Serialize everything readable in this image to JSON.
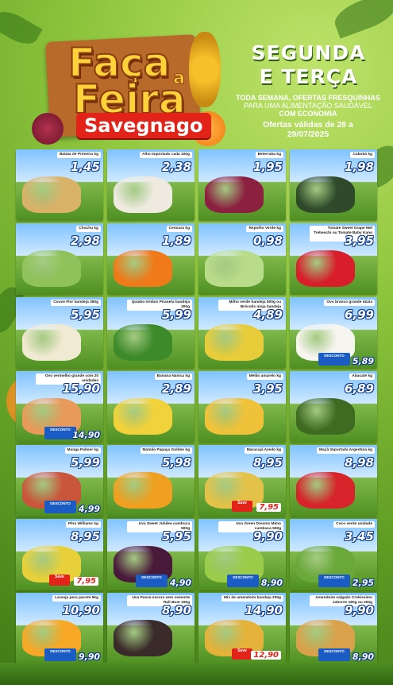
{
  "header": {
    "logo_line1": "Faça",
    "logo_connector": "a",
    "logo_line2": "Feira",
    "brand": "Savegnago",
    "days_line1": "SEGUNDA",
    "days_line2": "E TERÇA",
    "subtitle_line1": "TODA SEMANA, OFERTAS FRESQUINHAS",
    "subtitle_line2": "PARA UMA ALIMENTAÇÃO SAUDÁVEL",
    "subtitle_line3": "COM ECONOMIA",
    "validity_line1": "Ofertas válidas de 28 a",
    "validity_line2": "29/07/2025"
  },
  "currency": "R$",
  "products": [
    {
      "name": "Batata de Primeira kg",
      "price": "1,45",
      "color": "#d9b26a"
    },
    {
      "name": "Alho Importado cada 100g",
      "price": "2,38",
      "color": "#eeeae0"
    },
    {
      "name": "Beterraba kg",
      "price": "1,95",
      "color": "#8c2040"
    },
    {
      "name": "Cabotiá kg",
      "price": "1,98",
      "color": "#2f4a2a"
    },
    {
      "name": "Chuchu kg",
      "price": "2,98",
      "color": "#8fc25a"
    },
    {
      "name": "Cenoura kg",
      "price": "1,89",
      "color": "#f07a1a"
    },
    {
      "name": "Repolho Verde kg",
      "price": "0,98",
      "color": "#b9dc8a"
    },
    {
      "name": "Tomate Sweet Grape Mel Trebeschi ou Tomate Baby Kano 180g",
      "price": "3,95",
      "color": "#d81e2a"
    },
    {
      "name": "Couve Flor bandeja 350g",
      "price": "5,95",
      "color": "#f1ead2"
    },
    {
      "name": "Quiabo Irmãos Piraneta bandeja 300g",
      "price": "5,99",
      "color": "#3d8a2a"
    },
    {
      "name": "Milho verde bandeja 500g ou Brócolis ninja bandeja",
      "price": "4,89",
      "color": "#e8cc3a"
    },
    {
      "name": "Ovo branco grande dúzia",
      "price": "6,99",
      "color": "#f7f5ef",
      "discount_label": "DESCONTO",
      "discount_price": "5,89"
    },
    {
      "name": "Ovo vermelho grande com 20 unidades",
      "price": "15,90",
      "color": "#e89a5a",
      "discount_label": "DESCONTO",
      "discount_price": "14,90"
    },
    {
      "name": "Banana Nanica kg",
      "price": "2,89",
      "color": "#f2d23a"
    },
    {
      "name": "Melão amarelo kg",
      "price": "3,95",
      "color": "#f0c23a"
    },
    {
      "name": "Abacate kg",
      "price": "6,89",
      "color": "#3f6a22"
    },
    {
      "name": "Manga Palmer kg",
      "price": "5,99",
      "color": "#c9553a",
      "discount_label": "DESCONTO",
      "discount_price": "4,99"
    },
    {
      "name": "Mamão Papaya Golden kg",
      "price": "5,98",
      "color": "#f0a020"
    },
    {
      "name": "Maracujá Azedo kg",
      "price": "8,95",
      "color": "#e4c24a",
      "save_label": "Save",
      "save_price": "7,95"
    },
    {
      "name": "Maçã Importada Argentina kg",
      "price": "8,98",
      "color": "#d6242a"
    },
    {
      "name": "Pêra Williams kg",
      "price": "8,95",
      "color": "#e8d03a",
      "save_label": "Save",
      "save_price": "7,95"
    },
    {
      "name": "Uva Sweet Jubilee cumbuca 500g",
      "price": "5,95",
      "color": "#4a1a3a",
      "discount_label": "DESCONTO",
      "discount_price": "4,90"
    },
    {
      "name": "Uva Green Dreams Mimo cumbuca 500g",
      "price": "9,90",
      "color": "#9acc4a",
      "discount_label": "DESCONTO",
      "discount_price": "8,90"
    },
    {
      "name": "Coco verde unidade",
      "price": "3,45",
      "color": "#6aa83a",
      "discount_label": "DESCONTO",
      "discount_price": "2,95"
    },
    {
      "name": "Laranja pera pacote 5kg",
      "price": "10,90",
      "color": "#f6a826",
      "discount_label": "DESCONTO",
      "discount_price": "9,90"
    },
    {
      "name": "Uva Passa escura sem semente Rali Bom 150g",
      "price": "8,90",
      "color": "#3a2a2a"
    },
    {
      "name": "Mix de amendoim bandeja 250g",
      "price": "14,90",
      "color": "#e5b23a",
      "save_label": "Save",
      "save_price": "12,90"
    },
    {
      "name": "Amendoim salgado Crokissimo sabores 180g ou 200g",
      "price": "9,90",
      "color": "#d9a24a",
      "discount_label": "DESCONTO",
      "discount_price": "8,90"
    }
  ]
}
